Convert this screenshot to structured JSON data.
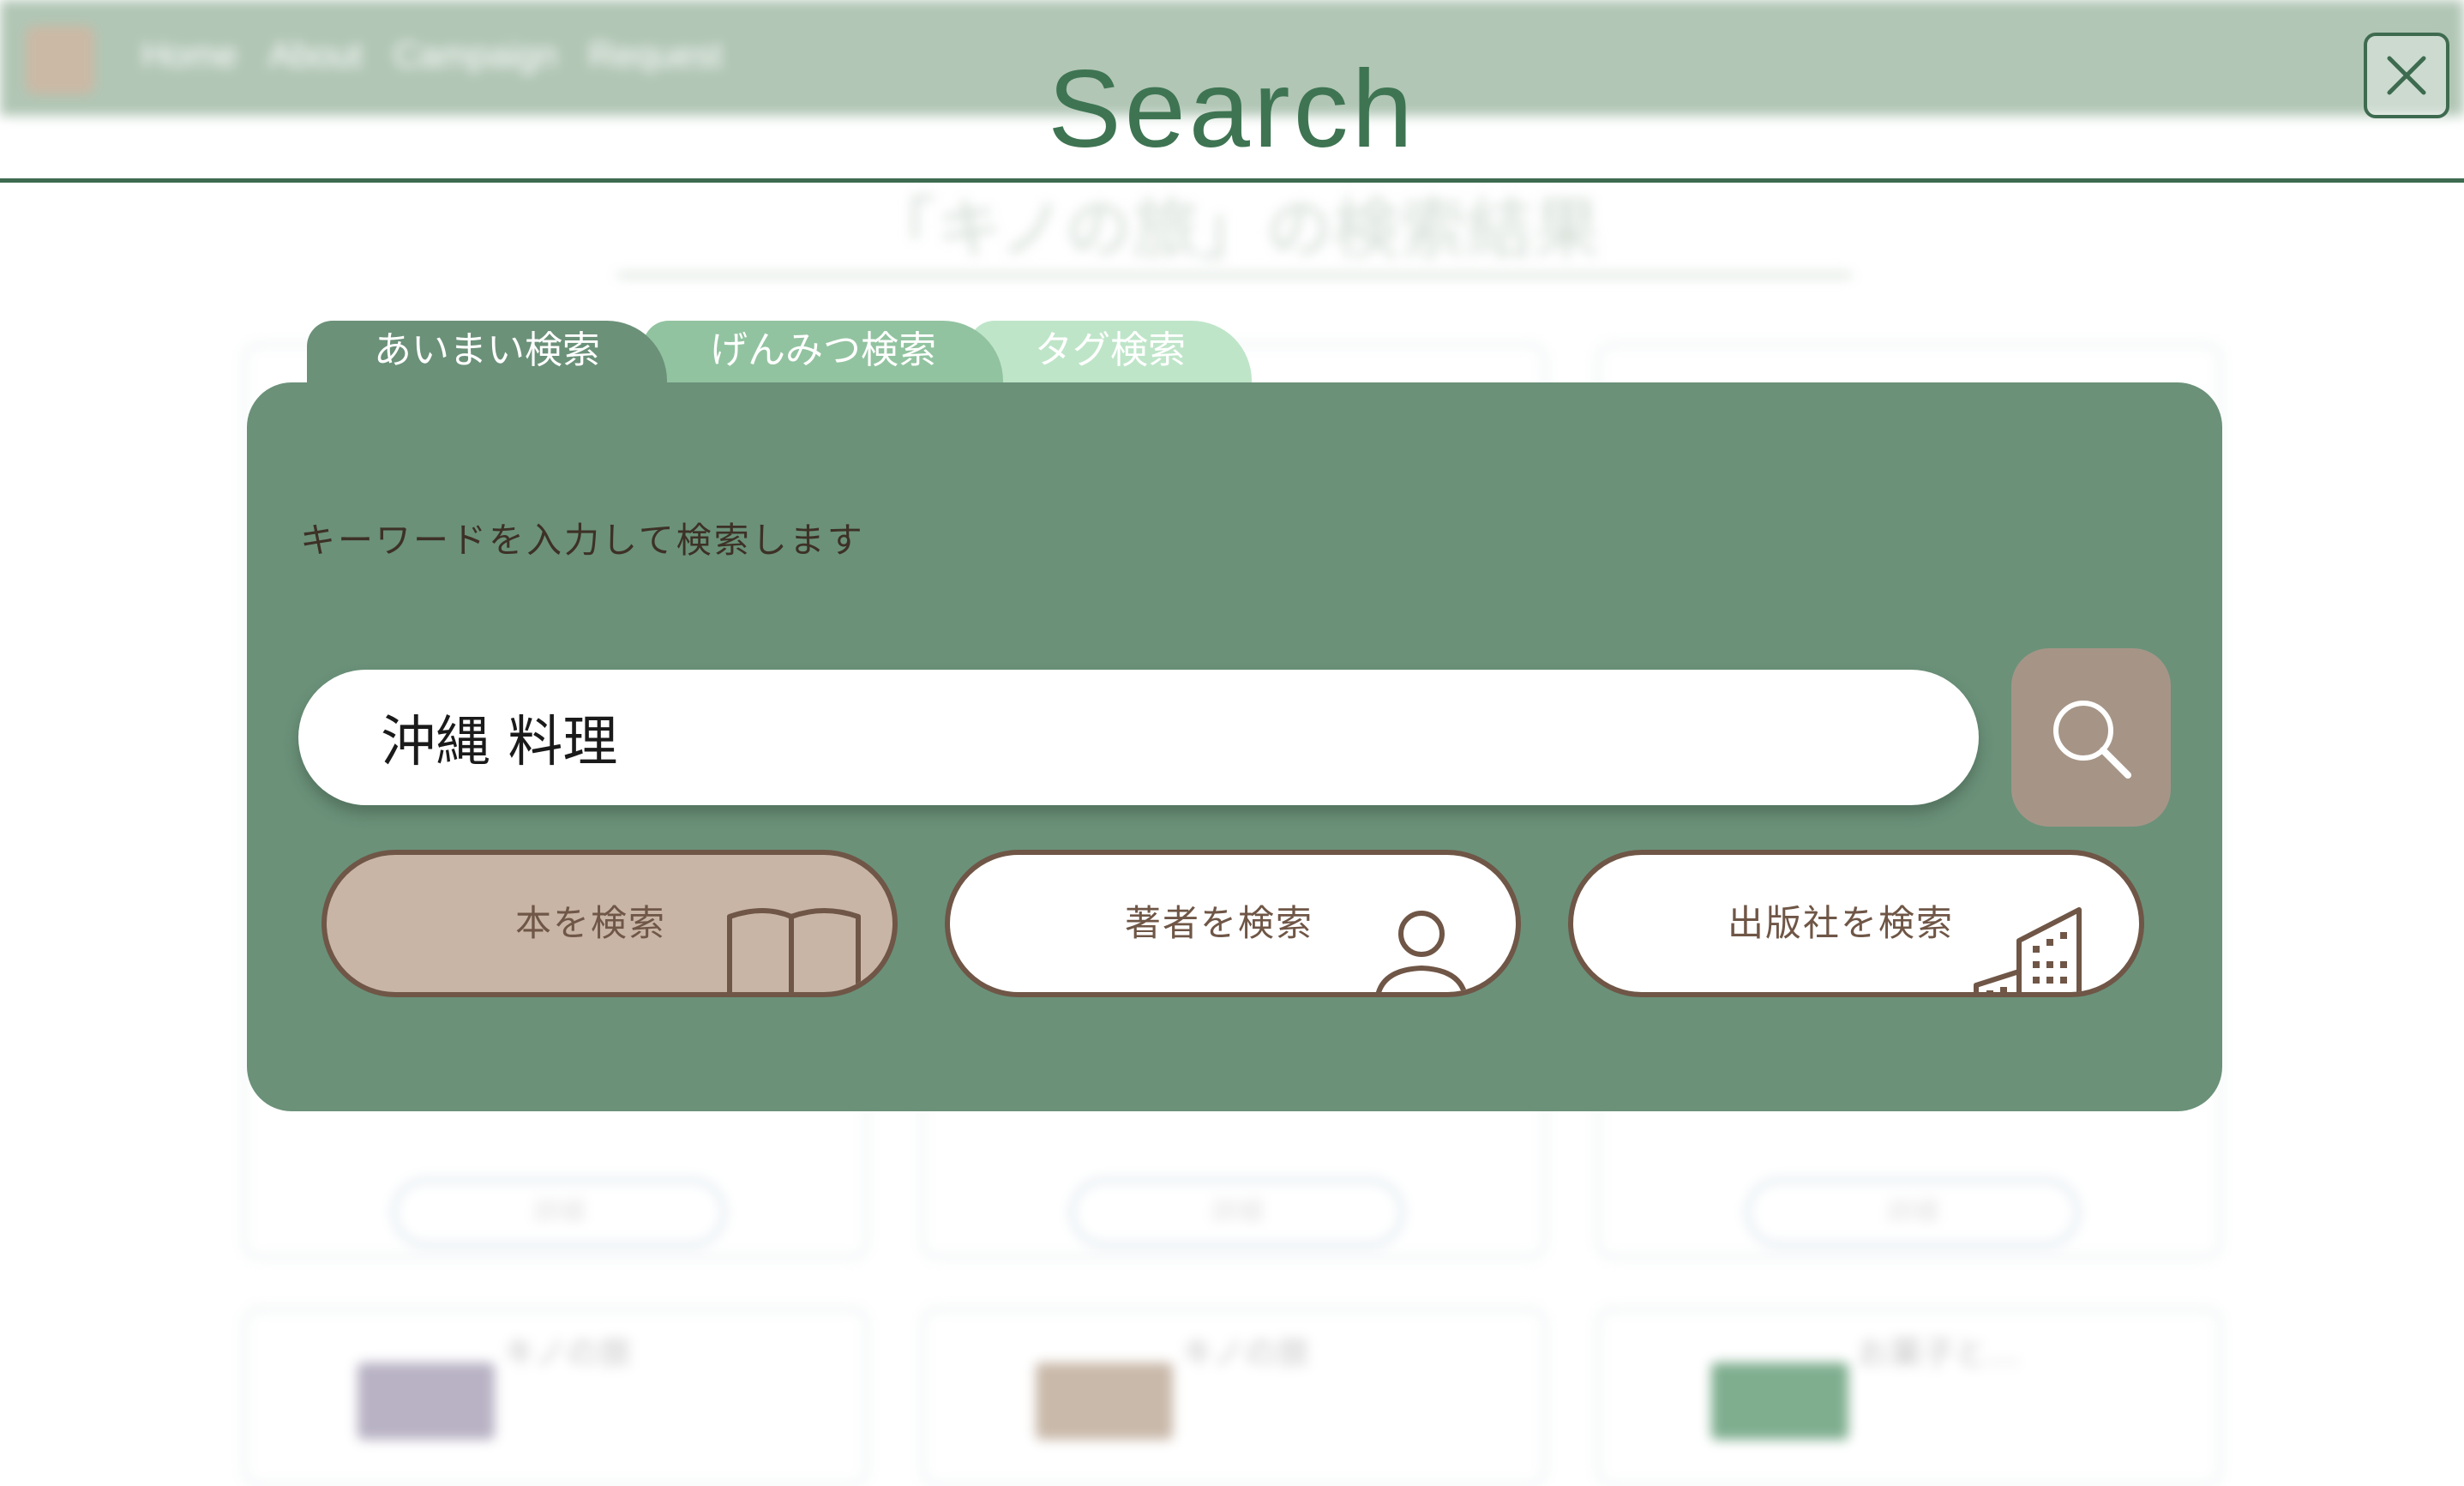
{
  "background": {
    "nav_links": [
      "Home",
      "About",
      "Campaign",
      "Request"
    ],
    "result_title": "「キノの旅」の検索結果",
    "cards_top": [
      {
        "text": "",
        "button": "詳細"
      },
      {
        "text": "",
        "button": "詳細"
      },
      {
        "text": "",
        "button": "詳細"
      }
    ],
    "cards_bottom": [
      {
        "text": "キノの旅"
      },
      {
        "text": "キノの旅"
      },
      {
        "text": "お菓子と…"
      }
    ]
  },
  "modal": {
    "heading": "Search",
    "close_icon": "close-icon"
  },
  "tabs": [
    {
      "label": "あいまい検索",
      "active": true
    },
    {
      "label": "げんみつ検索",
      "active": false
    },
    {
      "label": "タグ検索",
      "active": false
    }
  ],
  "panel": {
    "description": "キーワードを入力して検索します",
    "search_value": "沖縄 料理",
    "search_icon": "search-icon"
  },
  "categories": [
    {
      "label": "本を検索",
      "icon": "book-icon",
      "selected": true
    },
    {
      "label": "著者を検索",
      "icon": "person-icon",
      "selected": false
    },
    {
      "label": "出版社を検索",
      "icon": "building-icon",
      "selected": false
    }
  ],
  "colors": {
    "panel": "#6b9179",
    "heading": "#3e7452",
    "accent_brown": "#6f5646",
    "selected_fill": "#c8b5a6",
    "search_button": "#a69587"
  }
}
